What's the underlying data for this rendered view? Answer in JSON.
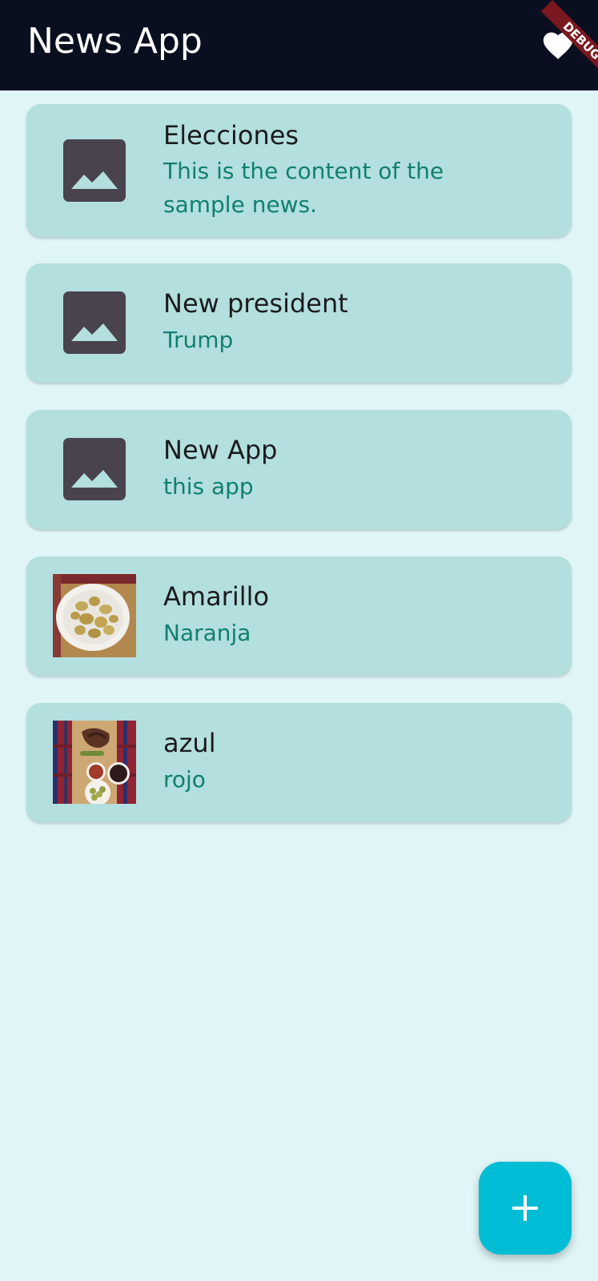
{
  "app_bar": {
    "title": "News App",
    "favorites_icon": "heart-icon",
    "debug_banner": "DEBUG"
  },
  "news": [
    {
      "title": "Elecciones",
      "content": "This is the content of the sample news.",
      "thumbnail": "image-placeholder-icon"
    },
    {
      "title": "New president",
      "content": "Trump",
      "thumbnail": "image-placeholder-icon"
    },
    {
      "title": "New App",
      "content": "this app",
      "thumbnail": "image-placeholder-icon"
    },
    {
      "title": "Amarillo",
      "content": "Naranja",
      "thumbnail": "photo-potatoes"
    },
    {
      "title": "azul",
      "content": "rojo",
      "thumbnail": "photo-food-board"
    }
  ],
  "fab": {
    "icon": "plus-icon"
  },
  "colors": {
    "app_bar": "#0A0F1F",
    "background": "#DFF5F8",
    "card": "#B3DFDE",
    "subtitle": "#11806E",
    "fab": "#00BCD4",
    "placeholder": "#48434D",
    "debug_banner": "#7A1820"
  }
}
